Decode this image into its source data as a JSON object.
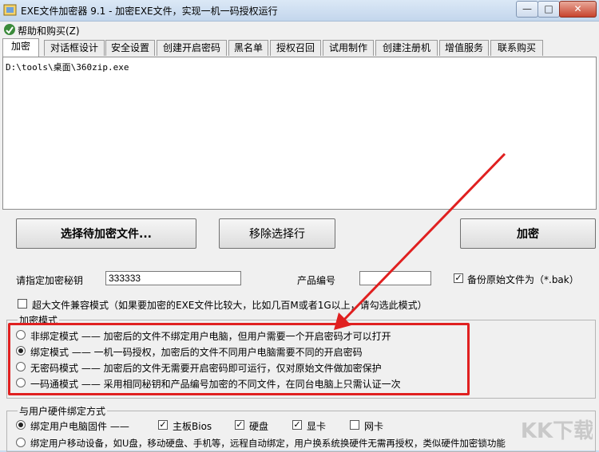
{
  "window": {
    "title": "EXE文件加密器 9.1 - 加密EXE文件，实现一机一码授权运行"
  },
  "menu": {
    "help": "帮助和购买(Z)"
  },
  "tabs": [
    {
      "label": "加密"
    },
    {
      "label": "对话框设计"
    },
    {
      "label": "安全设置"
    },
    {
      "label": "创建开启密码"
    },
    {
      "label": "黑名单"
    },
    {
      "label": "授权召回"
    },
    {
      "label": "试用制作"
    },
    {
      "label": "创建注册机"
    },
    {
      "label": "增值服务"
    },
    {
      "label": "联系购买"
    }
  ],
  "file_list": {
    "path": "D:\\tools\\桌面\\360zip.exe"
  },
  "buttons": {
    "select_file": "选择待加密文件...",
    "remove": "移除选择行",
    "encrypt": "加密"
  },
  "key": {
    "label": "请指定加密秘钥",
    "value": "333333"
  },
  "product": {
    "label": "产品编号",
    "value": ""
  },
  "backup": {
    "label": "备份原始文件为（*.bak）",
    "checked": true
  },
  "large_file": {
    "label": "超大文件兼容模式（如果要加密的EXE文件比较大，比如几百M或者1G以上，请勾选此模式）",
    "checked": false
  },
  "mode_group": {
    "title": "加密模式",
    "options": [
      {
        "label": "非绑定模式 —— 加密后的文件不绑定用户电脑，但用户需要一个开启密码才可以打开",
        "checked": false
      },
      {
        "label": "绑定模式 —— 一机一码授权，加密后的文件不同用户电脑需要不同的开启密码",
        "checked": true
      },
      {
        "label": "无密码模式 —— 加密后的文件无需要开启密码即可运行，仅对原始文件做加密保护",
        "checked": false
      },
      {
        "label": "一码通模式 —— 采用相同秘钥和产品编号加密的不同文件，在同台电脑上只需认证一次",
        "checked": false
      }
    ]
  },
  "hardware_group": {
    "title": "与用户硬件绑定方式",
    "option1": "绑定用户电脑固件 ——",
    "option1_checked": true,
    "hardware": [
      {
        "label": "主板Bios",
        "checked": true
      },
      {
        "label": "硬盘",
        "checked": true
      },
      {
        "label": "显卡",
        "checked": true
      },
      {
        "label": "网卡",
        "checked": false
      }
    ],
    "option2": "绑定用户移动设备，如U盘，移动硬盘、手机等，远程自动绑定，用户换系统换硬件无需再授权，类似硬件加密锁功能",
    "option2_checked": false
  },
  "watermark": {
    "text": "KK下载"
  },
  "colors": {
    "annotation": "#e02020",
    "title_bar": "#c3d6ec"
  }
}
